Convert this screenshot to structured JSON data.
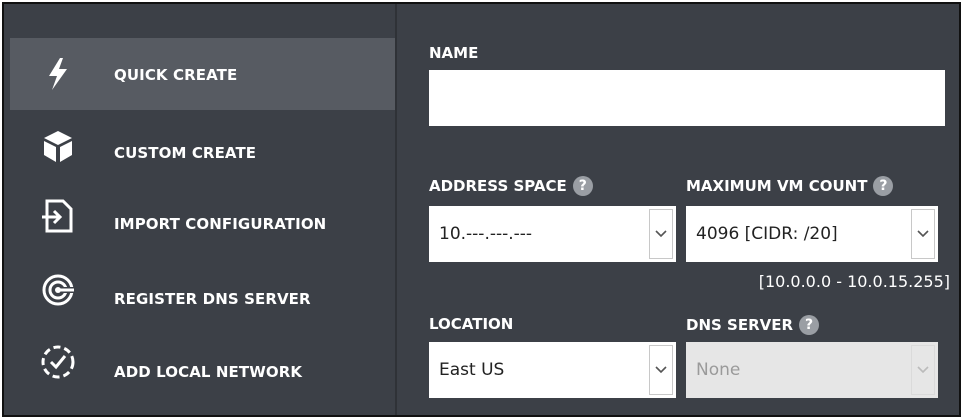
{
  "sidebar": {
    "items": [
      {
        "label": "QUICK CREATE",
        "icon": "lightning-bolt-icon",
        "active": true
      },
      {
        "label": "CUSTOM CREATE",
        "icon": "box-icon",
        "active": false
      },
      {
        "label": "IMPORT CONFIGURATION",
        "icon": "import-file-icon",
        "active": false
      },
      {
        "label": "REGISTER DNS SERVER",
        "icon": "dns-server-icon",
        "active": false
      },
      {
        "label": "ADD LOCAL NETWORK",
        "icon": "dashed-circle-check-icon",
        "active": false
      }
    ]
  },
  "form": {
    "name": {
      "label": "NAME",
      "value": "",
      "placeholder": ""
    },
    "address_space": {
      "label": "ADDRESS SPACE",
      "help": "?",
      "value": "10.---.---.---"
    },
    "max_vm_count": {
      "label": "MAXIMUM VM COUNT",
      "help": "?",
      "value": "4096 [CIDR: /20]",
      "range": "[10.0.0.0 - 10.0.15.255]"
    },
    "location": {
      "label": "LOCATION",
      "value": "East US"
    },
    "dns_server": {
      "label": "DNS SERVER",
      "help": "?",
      "value": "None",
      "disabled": true
    }
  },
  "colors": {
    "panel": "#3c4047",
    "active_item": "#575b62",
    "text": "#ffffff",
    "help_badge": "#9a9ea4",
    "disabled_field": "#e6e6e6"
  }
}
